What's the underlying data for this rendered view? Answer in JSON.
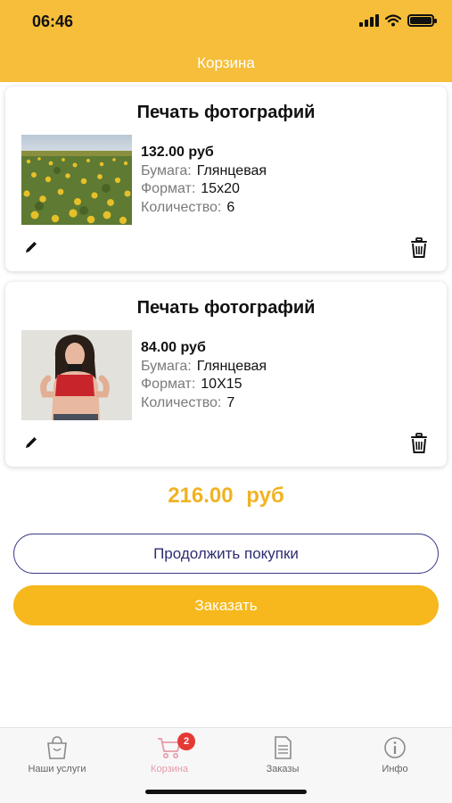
{
  "status": {
    "time": "06:46"
  },
  "header": {
    "title": "Корзина"
  },
  "items": [
    {
      "title": "Печать фотографий",
      "price": "132.00 руб",
      "paper_label": "Бумага:",
      "paper_value": "Глянцевая",
      "format_label": "Формат:",
      "format_value": "15x20",
      "qty_label": "Количество:",
      "qty_value": "6"
    },
    {
      "title": "Печать фотографий",
      "price": "84.00 руб",
      "paper_label": "Бумага:",
      "paper_value": "Глянцевая",
      "format_label": "Формат:",
      "format_value": "10X15",
      "qty_label": "Количество:",
      "qty_value": "7"
    }
  ],
  "total": "216.00 руб",
  "buttons": {
    "continue": "Продолжить покупки",
    "order": "Заказать"
  },
  "tabs": [
    {
      "label": "Наши услуги",
      "icon": "bag-icon"
    },
    {
      "label": "Корзина",
      "icon": "cart-icon",
      "badge": "2"
    },
    {
      "label": "Заказы",
      "icon": "document-icon"
    },
    {
      "label": "Инфо",
      "icon": "info-icon"
    }
  ],
  "colors": {
    "accent": "#f6be3a",
    "button": "#f6b81c",
    "total": "#f0b322",
    "active_tab": "#e79aa9"
  }
}
